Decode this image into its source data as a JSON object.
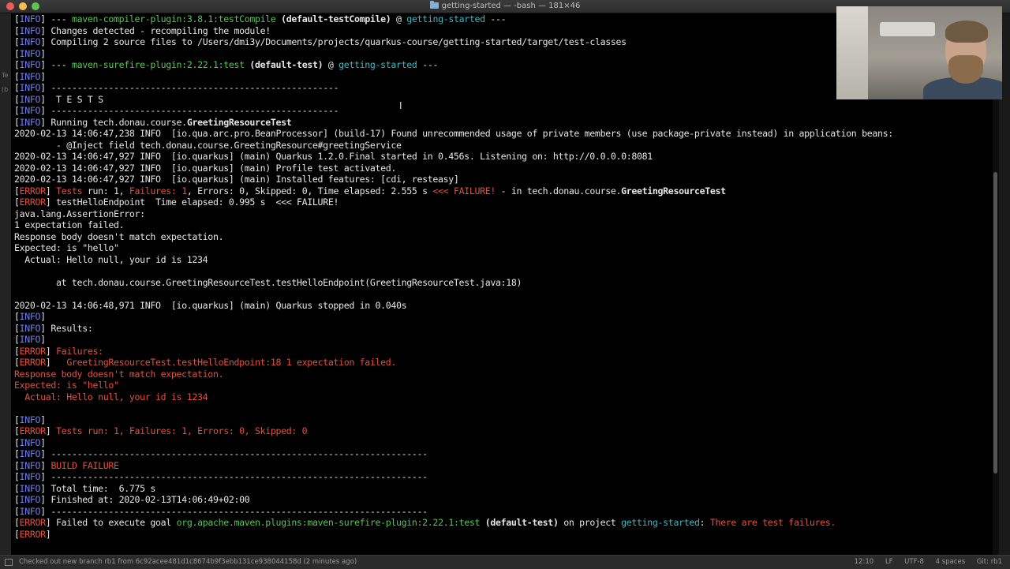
{
  "window": {
    "title": "getting-started — -bash — 181×46"
  },
  "gutter": {
    "glyph1": "Te",
    "glyph2": "(b"
  },
  "terminal": {
    "lines": [
      [
        {
          "t": "[",
          "c": "br"
        },
        {
          "t": "INFO",
          "c": "info"
        },
        {
          "t": "] --- ",
          "c": "br"
        },
        {
          "t": "maven-compiler-plugin:3.8.1:testCompile",
          "c": "grn"
        },
        {
          "t": " ",
          "c": "br"
        },
        {
          "t": "(default-testCompile)",
          "c": "b"
        },
        {
          "t": " @ ",
          "c": "br"
        },
        {
          "t": "getting-started",
          "c": "cyn"
        },
        {
          "t": " ---",
          "c": "br"
        }
      ],
      [
        {
          "t": "[",
          "c": "br"
        },
        {
          "t": "INFO",
          "c": "info"
        },
        {
          "t": "] Changes detected - recompiling the module!",
          "c": "br"
        }
      ],
      [
        {
          "t": "[",
          "c": "br"
        },
        {
          "t": "INFO",
          "c": "info"
        },
        {
          "t": "] Compiling 2 source files to /Users/dmi3y/Documents/projects/quarkus-course/getting-started/target/test-classes",
          "c": "br"
        }
      ],
      [
        {
          "t": "[",
          "c": "br"
        },
        {
          "t": "INFO",
          "c": "info"
        },
        {
          "t": "]",
          "c": "br"
        }
      ],
      [
        {
          "t": "[",
          "c": "br"
        },
        {
          "t": "INFO",
          "c": "info"
        },
        {
          "t": "] --- ",
          "c": "br"
        },
        {
          "t": "maven-surefire-plugin:2.22.1:test",
          "c": "grn"
        },
        {
          "t": " ",
          "c": "br"
        },
        {
          "t": "(default-test)",
          "c": "b"
        },
        {
          "t": " @ ",
          "c": "br"
        },
        {
          "t": "getting-started",
          "c": "cyn"
        },
        {
          "t": " ---",
          "c": "br"
        }
      ],
      [
        {
          "t": "[",
          "c": "br"
        },
        {
          "t": "INFO",
          "c": "info"
        },
        {
          "t": "]",
          "c": "br"
        }
      ],
      [
        {
          "t": "[",
          "c": "br"
        },
        {
          "t": "INFO",
          "c": "info"
        },
        {
          "t": "] -------------------------------------------------------",
          "c": "br"
        }
      ],
      [
        {
          "t": "[",
          "c": "br"
        },
        {
          "t": "INFO",
          "c": "info"
        },
        {
          "t": "]  T E S T S",
          "c": "br"
        }
      ],
      [
        {
          "t": "[",
          "c": "br"
        },
        {
          "t": "INFO",
          "c": "info"
        },
        {
          "t": "] -------------------------------------------------------",
          "c": "br"
        }
      ],
      [
        {
          "t": "[",
          "c": "br"
        },
        {
          "t": "INFO",
          "c": "info"
        },
        {
          "t": "] Running tech.donau.course.",
          "c": "br"
        },
        {
          "t": "GreetingResourceTest",
          "c": "b"
        }
      ],
      [
        {
          "t": "2020-02-13 14:06:47,238 INFO  [io.qua.arc.pro.BeanProcessor] (build-17) Found unrecommended usage of private members (use package-private instead) in application beans:",
          "c": "br"
        }
      ],
      [
        {
          "t": "        - @Inject field tech.donau.course.GreetingResource#greetingService",
          "c": "br"
        }
      ],
      [
        {
          "t": "2020-02-13 14:06:47,927 INFO  [io.quarkus] (main) Quarkus 1.2.0.Final started in 0.456s. Listening on: http://0.0.0.0:8081",
          "c": "br"
        }
      ],
      [
        {
          "t": "2020-02-13 14:06:47,927 INFO  [io.quarkus] (main) Profile test activated.",
          "c": "br"
        }
      ],
      [
        {
          "t": "2020-02-13 14:06:47,927 INFO  [io.quarkus] (main) Installed features: [cdi, resteasy]",
          "c": "br"
        }
      ],
      [
        {
          "t": "[",
          "c": "br"
        },
        {
          "t": "ERROR",
          "c": "err"
        },
        {
          "t": "] ",
          "c": "br"
        },
        {
          "t": "Tests",
          "c": "err"
        },
        {
          "t": " run: 1, ",
          "c": "br"
        },
        {
          "t": "Failures: 1",
          "c": "err"
        },
        {
          "t": ", Errors: 0, Skipped: 0, Time elapsed: 2.555 s ",
          "c": "br"
        },
        {
          "t": "<<< FAILURE!",
          "c": "err"
        },
        {
          "t": " - in tech.donau.course.",
          "c": "br"
        },
        {
          "t": "GreetingResourceTest",
          "c": "b"
        }
      ],
      [
        {
          "t": "[",
          "c": "br"
        },
        {
          "t": "ERROR",
          "c": "err"
        },
        {
          "t": "] testHelloEndpoint  Time elapsed: 0.995 s  <<< FAILURE!",
          "c": "br"
        }
      ],
      [
        {
          "t": "java.lang.AssertionError:",
          "c": "br"
        }
      ],
      [
        {
          "t": "1 expectation failed.",
          "c": "br"
        }
      ],
      [
        {
          "t": "Response body doesn't match expectation.",
          "c": "br"
        }
      ],
      [
        {
          "t": "Expected: is \"hello\"",
          "c": "br"
        }
      ],
      [
        {
          "t": "  Actual: Hello null, your id is 1234",
          "c": "br"
        }
      ],
      [
        {
          "t": "",
          "c": "br"
        }
      ],
      [
        {
          "t": "        at tech.donau.course.GreetingResourceTest.testHelloEndpoint(GreetingResourceTest.java:18)",
          "c": "br"
        }
      ],
      [
        {
          "t": "",
          "c": "br"
        }
      ],
      [
        {
          "t": "2020-02-13 14:06:48,971 INFO  [io.quarkus] (main) Quarkus stopped in 0.040s",
          "c": "br"
        }
      ],
      [
        {
          "t": "[",
          "c": "br"
        },
        {
          "t": "INFO",
          "c": "info"
        },
        {
          "t": "]",
          "c": "br"
        }
      ],
      [
        {
          "t": "[",
          "c": "br"
        },
        {
          "t": "INFO",
          "c": "info"
        },
        {
          "t": "] Results:",
          "c": "br"
        }
      ],
      [
        {
          "t": "[",
          "c": "br"
        },
        {
          "t": "INFO",
          "c": "info"
        },
        {
          "t": "]",
          "c": "br"
        }
      ],
      [
        {
          "t": "[",
          "c": "br"
        },
        {
          "t": "ERROR",
          "c": "err"
        },
        {
          "t": "] ",
          "c": "br"
        },
        {
          "t": "Failures:",
          "c": "err"
        }
      ],
      [
        {
          "t": "[",
          "c": "br"
        },
        {
          "t": "ERROR",
          "c": "err"
        },
        {
          "t": "] ",
          "c": "br"
        },
        {
          "t": "  GreetingResourceTest.testHelloEndpoint:18 1 expectation failed.",
          "c": "err"
        }
      ],
      [
        {
          "t": "Response body doesn't match expectation.",
          "c": "err"
        }
      ],
      [
        {
          "t": "Expected: is \"hello\"",
          "c": "err"
        }
      ],
      [
        {
          "t": "  Actual: Hello null, your id is 1234",
          "c": "err"
        }
      ],
      [
        {
          "t": "",
          "c": "br"
        }
      ],
      [
        {
          "t": "[",
          "c": "br"
        },
        {
          "t": "INFO",
          "c": "info"
        },
        {
          "t": "]",
          "c": "br"
        }
      ],
      [
        {
          "t": "[",
          "c": "br"
        },
        {
          "t": "ERROR",
          "c": "err"
        },
        {
          "t": "] ",
          "c": "br"
        },
        {
          "t": "Tests run: 1, Failures: 1, Errors: 0, Skipped: 0",
          "c": "err"
        }
      ],
      [
        {
          "t": "[",
          "c": "br"
        },
        {
          "t": "INFO",
          "c": "info"
        },
        {
          "t": "]",
          "c": "br"
        }
      ],
      [
        {
          "t": "[",
          "c": "br"
        },
        {
          "t": "INFO",
          "c": "info"
        },
        {
          "t": "] ------------------------------------------------------------------------",
          "c": "br"
        }
      ],
      [
        {
          "t": "[",
          "c": "br"
        },
        {
          "t": "INFO",
          "c": "info"
        },
        {
          "t": "] ",
          "c": "br"
        },
        {
          "t": "BUILD FAILURE",
          "c": "err"
        }
      ],
      [
        {
          "t": "[",
          "c": "br"
        },
        {
          "t": "INFO",
          "c": "info"
        },
        {
          "t": "] ------------------------------------------------------------------------",
          "c": "br"
        }
      ],
      [
        {
          "t": "[",
          "c": "br"
        },
        {
          "t": "INFO",
          "c": "info"
        },
        {
          "t": "] Total time:  6.775 s",
          "c": "br"
        }
      ],
      [
        {
          "t": "[",
          "c": "br"
        },
        {
          "t": "INFO",
          "c": "info"
        },
        {
          "t": "] Finished at: 2020-02-13T14:06:49+02:00",
          "c": "br"
        }
      ],
      [
        {
          "t": "[",
          "c": "br"
        },
        {
          "t": "INFO",
          "c": "info"
        },
        {
          "t": "] ------------------------------------------------------------------------",
          "c": "br"
        }
      ],
      [
        {
          "t": "[",
          "c": "br"
        },
        {
          "t": "ERROR",
          "c": "err"
        },
        {
          "t": "] Failed to execute goal ",
          "c": "br"
        },
        {
          "t": "org.apache.maven.plugins:maven-surefire-plugin:2.22.1:test",
          "c": "grn"
        },
        {
          "t": " ",
          "c": "br"
        },
        {
          "t": "(default-test)",
          "c": "b"
        },
        {
          "t": " on project ",
          "c": "br"
        },
        {
          "t": "getting-started",
          "c": "cyn"
        },
        {
          "t": ": ",
          "c": "br"
        },
        {
          "t": "There are test failures.",
          "c": "err"
        }
      ],
      [
        {
          "t": "[",
          "c": "br"
        },
        {
          "t": "ERROR",
          "c": "err"
        },
        {
          "t": "]",
          "c": "br"
        }
      ]
    ]
  },
  "statusbar": {
    "message": "Checked out new branch rb1 from 6c92acee481d1c8674b9f3ebb131ce938044158d (2 minutes ago)",
    "position": "12:10",
    "line_ending": "LF",
    "encoding": "UTF-8",
    "indent": "4 spaces",
    "git": "Git: rb1"
  },
  "colors": {
    "info": "#6f7ff2",
    "error": "#e0513f",
    "plugin": "#57c456",
    "project": "#3fb7c3",
    "background": "#000000"
  }
}
